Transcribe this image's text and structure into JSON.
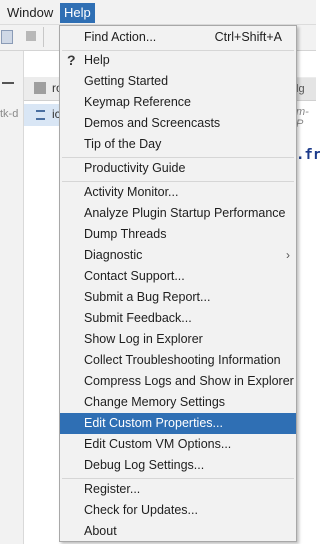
{
  "menubar": {
    "window_label": "Window",
    "help_label": "Help"
  },
  "background": {
    "left_panel_text": "tk-d",
    "tab_file_1": "ro",
    "tab_file_2": "ic",
    "right_tab_text": "lg",
    "right_italic_text": "m-P",
    "right_code_text": ".fr"
  },
  "help_menu": {
    "items": [
      {
        "label": "Find Action...",
        "shortcut": "Ctrl+Shift+A"
      },
      {
        "label": "Help",
        "icon": "question-mark-icon"
      },
      {
        "label": "Getting Started"
      },
      {
        "label": "Keymap Reference"
      },
      {
        "label": "Demos and Screencasts"
      },
      {
        "label": "Tip of the Day"
      },
      {
        "label": "Productivity Guide"
      },
      {
        "label": "Activity Monitor..."
      },
      {
        "label": "Analyze Plugin Startup Performance"
      },
      {
        "label": "Dump Threads"
      },
      {
        "label": "Diagnostic",
        "submenu_arrow": "›"
      },
      {
        "label": "Contact Support..."
      },
      {
        "label": "Submit a Bug Report..."
      },
      {
        "label": "Submit Feedback..."
      },
      {
        "label": "Show Log in Explorer"
      },
      {
        "label": "Collect Troubleshooting Information"
      },
      {
        "label": "Compress Logs and Show in Explorer"
      },
      {
        "label": "Change Memory Settings"
      },
      {
        "label": "Edit Custom Properties...",
        "selected": true
      },
      {
        "label": "Edit Custom VM Options..."
      },
      {
        "label": "Debug Log Settings..."
      },
      {
        "label": "Register..."
      },
      {
        "label": "Check for Updates..."
      },
      {
        "label": "About"
      }
    ],
    "icon_question": "?"
  },
  "colors": {
    "selection": "#2f6fb4",
    "menu_background": "#f2f2f2"
  }
}
